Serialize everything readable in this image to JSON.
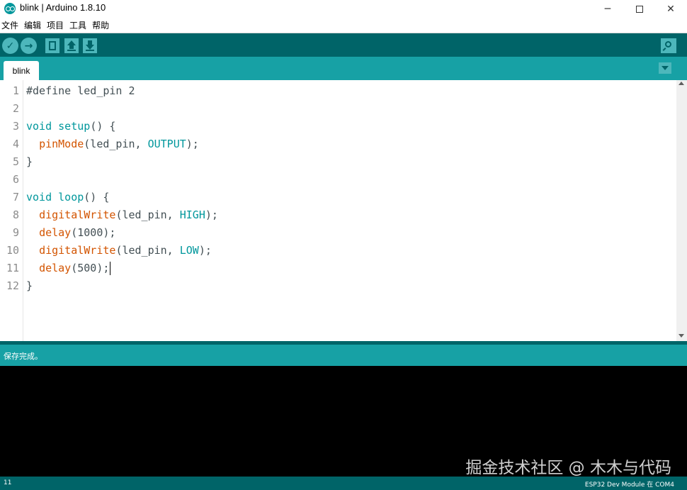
{
  "window": {
    "title": "blink | Arduino 1.8.10",
    "minimize_glyph": "─",
    "close_glyph": "✕"
  },
  "menubar": {
    "items": [
      "文件",
      "编辑",
      "项目",
      "工具",
      "帮助"
    ]
  },
  "toolbar": {
    "verify_glyph": "✓",
    "upload_glyph": "→"
  },
  "tabs": [
    {
      "label": "blink"
    }
  ],
  "editor": {
    "line_numbers": [
      "1",
      "2",
      "3",
      "4",
      "5",
      "6",
      "7",
      "8",
      "9",
      "10",
      "11",
      "12"
    ],
    "lines": [
      [
        {
          "t": "#define led_pin 2",
          "c": "plain"
        }
      ],
      [],
      [
        {
          "t": "void",
          "c": "kw"
        },
        {
          "t": " ",
          "c": "plain"
        },
        {
          "t": "setup",
          "c": "kw"
        },
        {
          "t": "() {",
          "c": "plain"
        }
      ],
      [
        {
          "t": "  ",
          "c": "plain"
        },
        {
          "t": "pinMode",
          "c": "fn"
        },
        {
          "t": "(led_pin, ",
          "c": "plain"
        },
        {
          "t": "OUTPUT",
          "c": "cst"
        },
        {
          "t": ");",
          "c": "plain"
        }
      ],
      [
        {
          "t": "}",
          "c": "plain"
        }
      ],
      [],
      [
        {
          "t": "void",
          "c": "kw"
        },
        {
          "t": " ",
          "c": "plain"
        },
        {
          "t": "loop",
          "c": "kw"
        },
        {
          "t": "() {",
          "c": "plain"
        }
      ],
      [
        {
          "t": "  ",
          "c": "plain"
        },
        {
          "t": "digitalWrite",
          "c": "fn"
        },
        {
          "t": "(led_pin, ",
          "c": "plain"
        },
        {
          "t": "HIGH",
          "c": "cst"
        },
        {
          "t": ");",
          "c": "plain"
        }
      ],
      [
        {
          "t": "  ",
          "c": "plain"
        },
        {
          "t": "delay",
          "c": "fn"
        },
        {
          "t": "(1000);",
          "c": "plain"
        }
      ],
      [
        {
          "t": "  ",
          "c": "plain"
        },
        {
          "t": "digitalWrite",
          "c": "fn"
        },
        {
          "t": "(led_pin, ",
          "c": "plain"
        },
        {
          "t": "LOW",
          "c": "cst"
        },
        {
          "t": ");",
          "c": "plain"
        }
      ],
      [
        {
          "t": "  ",
          "c": "plain"
        },
        {
          "t": "delay",
          "c": "fn"
        },
        {
          "t": "(500);",
          "c": "plain"
        }
      ],
      [
        {
          "t": "}",
          "c": "plain"
        }
      ]
    ],
    "caret_line": 11
  },
  "status": {
    "message": "保存完成。"
  },
  "console": {
    "watermark": "掘金技术社区 @ 木木与代码"
  },
  "footer": {
    "line_number": "11",
    "board_info": "ESP32 Dev Module 在 COM4"
  },
  "colors": {
    "toolbar_bg": "#006468",
    "tabbar_bg": "#17a1a5",
    "keyword": "#00979c",
    "function": "#d35400"
  }
}
